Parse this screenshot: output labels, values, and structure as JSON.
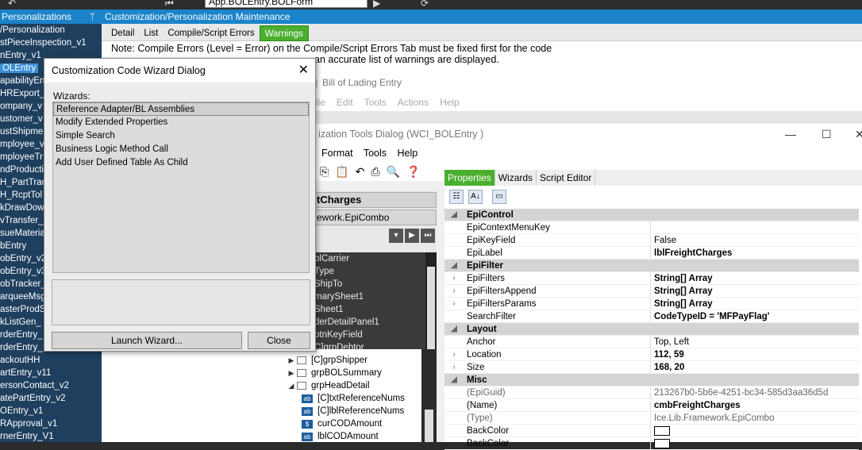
{
  "toolbar": {
    "assembly_input": "App.BOLEntry.BOLForm"
  },
  "left_panel": {
    "header": "Personalizations",
    "items": [
      "/Personalization",
      "stPieceInspection_v1",
      "nEntry_v1",
      "OLEntry",
      "apabilityEn",
      "HRExport_",
      "ompany_v",
      "ustomer_v",
      "ustShipme",
      "mployee_v",
      "mployeeTr",
      "ndProducti",
      "H_PartTrac",
      "H_RcptTol",
      "kDrawDow",
      "vTransfer_",
      "sueMateria",
      "bEntry",
      "obEntry_v2",
      "obEntry_v3",
      "obTracker_",
      "arqueeMsg",
      "asterProdS",
      "kListGen_",
      "rderEntry_",
      "rderEntry_",
      "ackoutHH",
      "artEntry_v11",
      "ersonContact_v2",
      "atePartEntry_v2",
      "OEntry_v1",
      "RApproval_v1",
      "rnerEntry_V1"
    ]
  },
  "maintenance": {
    "title": "Customization/Personalization Maintenance",
    "tabs": [
      "Detail",
      "List",
      "Compile/Script Errors",
      "Warnings"
    ],
    "note_line1": "Note: Compile Errors (Level = Error) on the Compile/Script Errors Tab  must be fixed first for the code",
    "note_line2": "an accurate list of warnings are displayed."
  },
  "bol": {
    "title": "Bill of Lading Entry",
    "menu": [
      "ile",
      "Edit",
      "Tools",
      "Actions",
      "Help"
    ]
  },
  "ctd": {
    "title": "ization Tools Dialog  (WCI_BOLEntry )",
    "menu": [
      "Format",
      "Tools",
      "Help"
    ],
    "control_name": "tCharges",
    "control_type": "ework.EpiCombo",
    "tree_items": [
      "blCarrier",
      "Type",
      "ShipTo",
      "marySheet1",
      "Sheet1",
      "derDetailPanel1",
      "otnKeyField",
      "C]grpDebtor"
    ],
    "tree2_items": [
      {
        "label": "[C]grpShipper",
        "kind": "folder",
        "exp": "▶"
      },
      {
        "label": "grpBOLSummary",
        "kind": "folder",
        "exp": "▶"
      },
      {
        "label": "grpHeadDetail",
        "kind": "folder",
        "exp": "◢"
      },
      {
        "label": "[C]txtReferenceNums",
        "kind": "ab",
        "exp": ""
      },
      {
        "label": "[C]lblReferenceNums",
        "kind": "ab",
        "exp": ""
      },
      {
        "label": "curCODAmount",
        "kind": "$",
        "exp": ""
      },
      {
        "label": "lblCODAmount",
        "kind": "ab",
        "exp": ""
      }
    ]
  },
  "props": {
    "tabs": [
      "Properties",
      "Wizards",
      "Script Editor"
    ],
    "rows": [
      {
        "cat": true,
        "name": "EpiControl"
      },
      {
        "name": "EpiContextMenuKey",
        "value": ""
      },
      {
        "name": "EpiKeyField",
        "value": "False"
      },
      {
        "name": "EpiLabel",
        "value": "lblFreightCharges",
        "bold": true
      },
      {
        "cat": true,
        "name": "EpiFilter"
      },
      {
        "name": "EpiFilters",
        "value": "String[] Array",
        "bold": true,
        "exp": true
      },
      {
        "name": "EpiFiltersAppend",
        "value": "String[] Array",
        "bold": true,
        "exp": true
      },
      {
        "name": "EpiFiltersParams",
        "value": "String[] Array",
        "bold": true,
        "exp": true
      },
      {
        "name": "SearchFilter",
        "value": "CodeTypeID = 'MFPayFlag'",
        "bold": true
      },
      {
        "cat": true,
        "name": "Layout"
      },
      {
        "name": "Anchor",
        "value": "Top, Left"
      },
      {
        "name": "Location",
        "value": "112, 59",
        "bold": true,
        "exp": true
      },
      {
        "name": "Size",
        "value": "168, 20",
        "bold": true,
        "exp": true
      },
      {
        "cat": true,
        "name": "Misc"
      },
      {
        "name": "(EpiGuid)",
        "value": "213267b0-5b6e-4251-bc34-585d3aa36d5d",
        "gray": true
      },
      {
        "name": "(Name)",
        "value": "cmbFreightCharges",
        "bold": true
      },
      {
        "name": "(Type)",
        "value": "Ice.Lib.Framework.EpiCombo",
        "gray": true
      },
      {
        "name": "BackColor",
        "value": "",
        "swatch": true
      },
      {
        "name": "BackColor",
        "value": "",
        "swatch": true
      }
    ]
  },
  "wizard": {
    "title": "Customization Code Wizard Dialog",
    "label": "Wizards:",
    "items": [
      "Reference Adapter/BL Assemblies",
      "Modify Extended Properties",
      "Simple Search",
      "Business Logic Method Call",
      "Add User Defined Table As Child"
    ],
    "launch": "Launch Wizard...",
    "close": "Close"
  }
}
